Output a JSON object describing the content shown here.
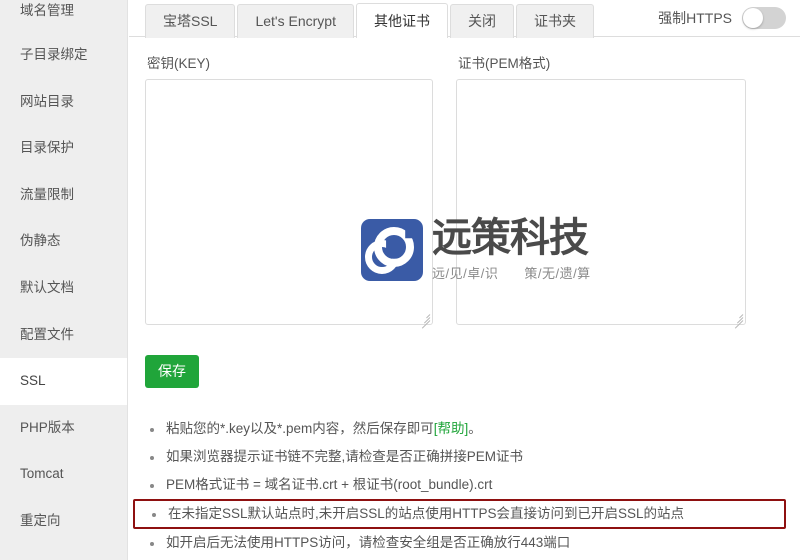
{
  "sidebar": {
    "items": [
      {
        "label": "域名管理",
        "active": false
      },
      {
        "label": "子目录绑定",
        "active": false
      },
      {
        "label": "网站目录",
        "active": false
      },
      {
        "label": "目录保护",
        "active": false
      },
      {
        "label": "流量限制",
        "active": false
      },
      {
        "label": "伪静态",
        "active": false
      },
      {
        "label": "默认文档",
        "active": false
      },
      {
        "label": "配置文件",
        "active": false
      },
      {
        "label": "SSL",
        "active": true
      },
      {
        "label": "PHP版本",
        "active": false
      },
      {
        "label": "Tomcat",
        "active": false
      },
      {
        "label": "重定向",
        "active": false
      }
    ]
  },
  "tabs": [
    {
      "label": "宝塔SSL",
      "active": false
    },
    {
      "label": "Let's Encrypt",
      "active": false
    },
    {
      "label": "其他证书",
      "active": true
    },
    {
      "label": "关闭",
      "active": false
    },
    {
      "label": "证书夹",
      "active": false
    }
  ],
  "force_https": {
    "label": "强制HTTPS",
    "enabled": false
  },
  "fields": {
    "key": {
      "label": "密钥(KEY)",
      "value": "",
      "placeholder": ""
    },
    "pem": {
      "label": "证书(PEM格式)",
      "value": "",
      "placeholder": ""
    }
  },
  "watermark": {
    "main": "远策科技",
    "sub_left": "远/见/卓/识",
    "sub_right": "策/无/遗/算",
    "mark_color": "#3a5ba6"
  },
  "buttons": {
    "save": "保存"
  },
  "tips": [
    {
      "prefix": "粘贴您的*.key以及*.pem内容，然后保存即可",
      "link": "[帮助]",
      "suffix": "。",
      "highlight": false
    },
    {
      "prefix": "如果浏览器提示证书链不完整,请检查是否正确拼接PEM证书",
      "link": "",
      "suffix": "",
      "highlight": false
    },
    {
      "prefix": "PEM格式证书 = 域名证书.crt + 根证书(root_bundle).crt",
      "link": "",
      "suffix": "",
      "highlight": false
    },
    {
      "prefix": "在未指定SSL默认站点时,未开启SSL的站点使用HTTPS会直接访问到已开启SSL的站点",
      "link": "",
      "suffix": "",
      "highlight": true
    },
    {
      "prefix": "如开启后无法使用HTTPS访问，请检查安全组是否正确放行443端口",
      "link": "",
      "suffix": "",
      "highlight": false
    }
  ],
  "colors": {
    "accent_green": "#20a53a",
    "highlight_red": "#8e1010",
    "sidebar_bg": "#eeeeee"
  }
}
